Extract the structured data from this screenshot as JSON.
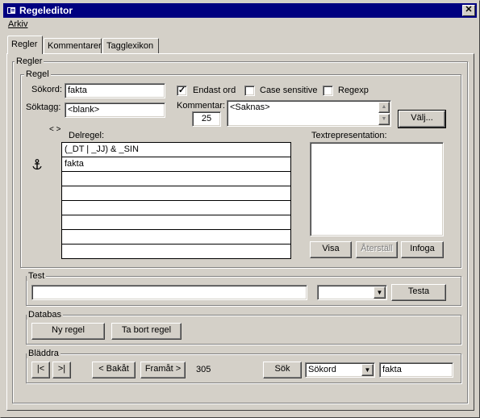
{
  "window": {
    "title": "Regeleditor",
    "close_label": "✕"
  },
  "menu": {
    "arkiv": "Arkiv"
  },
  "tabs": [
    {
      "label": "Regler"
    },
    {
      "label": "Kommentarer"
    },
    {
      "label": "Tagglexikon"
    }
  ],
  "regler": {
    "group_label": "Regler",
    "regel": {
      "group_label": "Regel",
      "sokord_label": "Sökord:",
      "sokord_value": "fakta",
      "soktagg_label": "Söktagg:",
      "soktagg_value": "<blank>",
      "endast_ord_label": "Endast ord",
      "endast_ord_checked": true,
      "case_sensitive_label": "Case sensitive",
      "case_sensitive_checked": false,
      "regexp_label": "Regexp",
      "regexp_checked": false,
      "kommentar_label": "Kommentar:",
      "kommentar_number": "25",
      "kommentar_text": "<Saknas>",
      "valj_label": "Välj...",
      "arrows_label": "< >",
      "anchor_icon": "anchor-icon",
      "delregel_label": "Delregel:",
      "delregel_rows": [
        "(_DT | _JJ) & _SIN",
        "fakta",
        "",
        "",
        "",
        "",
        "",
        ""
      ],
      "textrep_label": "Textrepresentation:",
      "textrep_value": "",
      "visa_label": "Visa",
      "aterstall_label": "Återställ",
      "infoga_label": "Infoga"
    },
    "test": {
      "group_label": "Test",
      "input_value": "",
      "combo_value": "",
      "testa_label": "Testa"
    },
    "databas": {
      "group_label": "Databas",
      "ny_regel_label": "Ny regel",
      "ta_bort_label": "Ta bort regel"
    },
    "bladdra": {
      "group_label": "Bläddra",
      "first_label": "|<",
      "last_label": ">|",
      "bakat_label": "< Bakåt",
      "framat_label": "Framåt >",
      "counter": "305",
      "sok_label": "Sök",
      "field_combo_value": "Sökord",
      "search_value": "fakta"
    }
  },
  "colors": {
    "titlebar": "#000080",
    "face": "#d4d0c8"
  }
}
